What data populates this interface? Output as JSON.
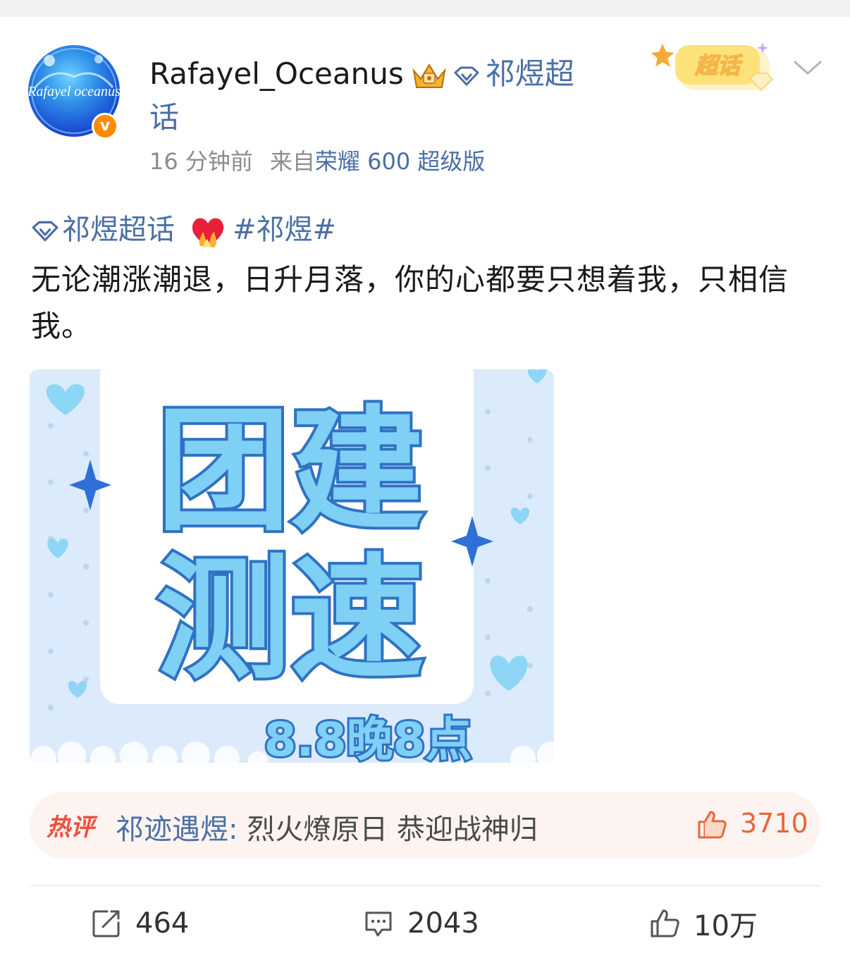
{
  "post": {
    "username": "Rafayel_Oceanus",
    "topic_name_part1": "祁煜超",
    "topic_name_part2": "话",
    "time": "16 分钟前",
    "source_prefix": "来自",
    "source_device": "荣耀 600 超级版",
    "badge_label": "超话",
    "avatar_text": "Rafayel oceanus",
    "topic_tag": "祁煜超话",
    "hashtag": "#祁煜#",
    "text": "无论潮涨潮退，日升月落，你的心都要只想着我，只相信我。",
    "image": {
      "line1": "团建",
      "line2": "测速",
      "caption": "8.8晚8点"
    }
  },
  "hot_comment": {
    "label": "热评",
    "user": "祁迹遇煜:",
    "text": " 烈火燎原日 恭迎战神归",
    "likes": "3710"
  },
  "actions": {
    "repost_count": "464",
    "comment_count": "2043",
    "like_count": "10万"
  },
  "colors": {
    "link": "#4a6fa5",
    "hot": "#ef4f3c",
    "like_orange": "#e8663a",
    "image_blue": "#7fd0f5"
  }
}
